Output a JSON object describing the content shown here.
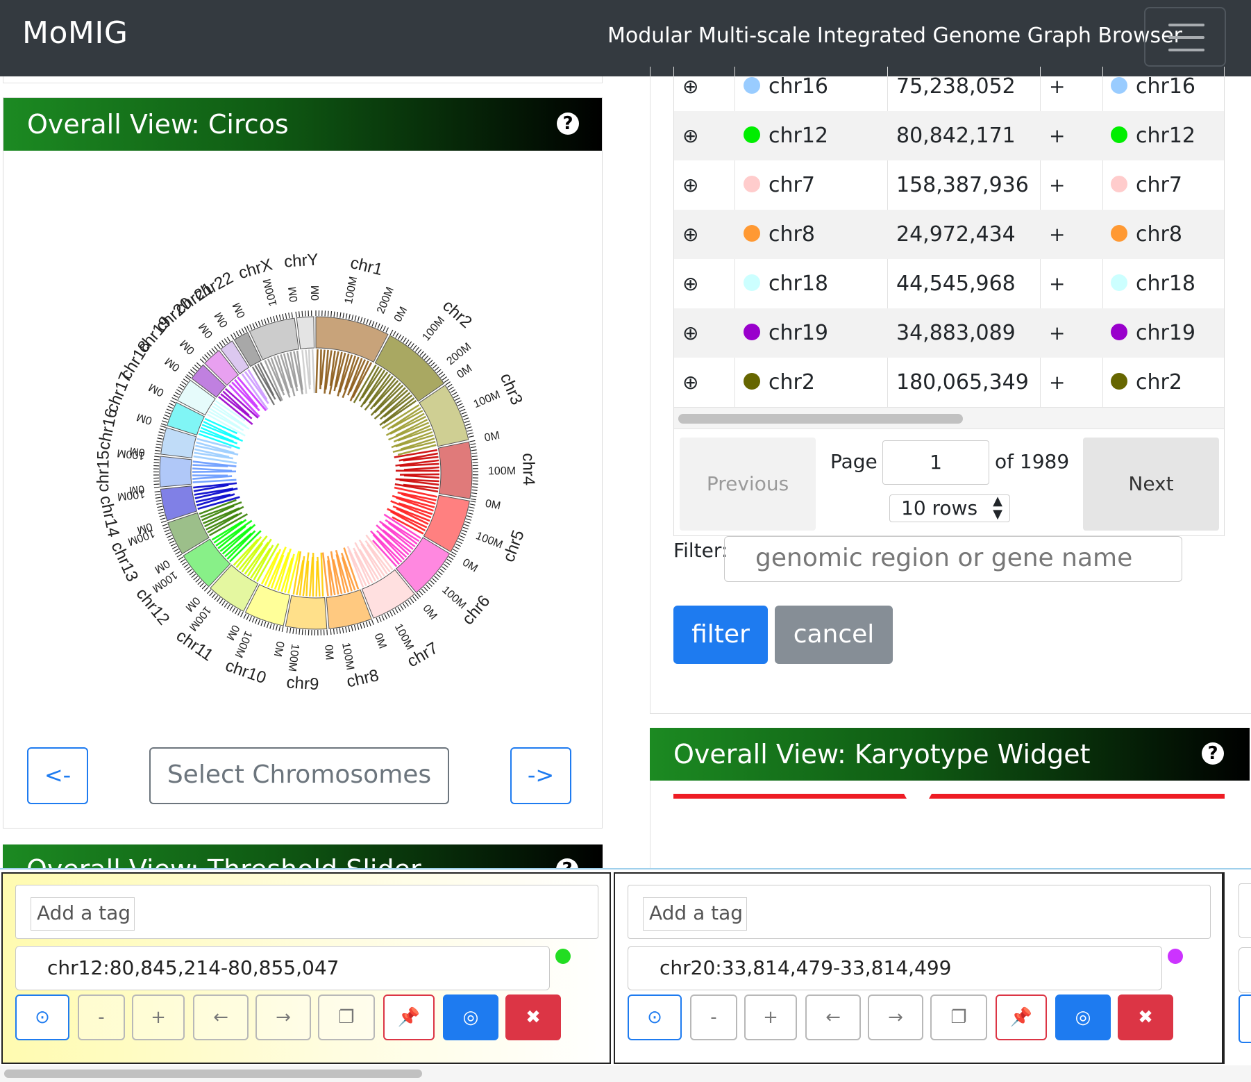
{
  "navbar": {
    "brand": "MoMIG",
    "title": "Modular Multi-scale Integrated Genome Graph Browser"
  },
  "circos_panel": {
    "header": "Overall View: Circos",
    "help": "?",
    "prev_label": "<-",
    "next_label": "->",
    "select_label": "Select Chromosomes",
    "chromosomes": [
      {
        "name": "chr1",
        "color": "#c8a37a",
        "ribbon": "#8b5a16"
      },
      {
        "name": "chr2",
        "color": "#a9a862",
        "ribbon": "#6b6b16"
      },
      {
        "name": "chr3",
        "color": "#cfcf93",
        "ribbon": "#9a9a2c"
      },
      {
        "name": "chr4",
        "color": "#e07a7a",
        "ribbon": "#cc0000"
      },
      {
        "name": "chr5",
        "color": "#ff8080",
        "ribbon": "#ff1a1a"
      },
      {
        "name": "chr6",
        "color": "#ff88e0",
        "ribbon": "#ff33cc"
      },
      {
        "name": "chr7",
        "color": "#ffe0e0",
        "ribbon": "#ffcccc"
      },
      {
        "name": "chr8",
        "color": "#ffc980",
        "ribbon": "#ff9933"
      },
      {
        "name": "chr9",
        "color": "#ffe08a",
        "ribbon": "#ffcc00"
      },
      {
        "name": "chr10",
        "color": "#ffff99",
        "ribbon": "#ffff00"
      },
      {
        "name": "chr11",
        "color": "#e4f7a0",
        "ribbon": "#ccff00"
      },
      {
        "name": "chr12",
        "color": "#88f088",
        "ribbon": "#00ff00"
      },
      {
        "name": "chr13",
        "color": "#9cbf8a",
        "ribbon": "#358000"
      },
      {
        "name": "chr14",
        "color": "#8080e6",
        "ribbon": "#0000cc"
      },
      {
        "name": "chr15",
        "color": "#b0c8f8",
        "ribbon": "#6699ff"
      },
      {
        "name": "chr16",
        "color": "#c0dcf8",
        "ribbon": "#99ccff"
      },
      {
        "name": "chr17",
        "color": "#80f5f5",
        "ribbon": "#00ffff"
      },
      {
        "name": "chr18",
        "color": "#e6fbfb",
        "ribbon": "#ccffff"
      },
      {
        "name": "chr19",
        "color": "#c080e0",
        "ribbon": "#9900cc"
      },
      {
        "name": "chr20",
        "color": "#e8a0f0",
        "ribbon": "#cc33ff"
      },
      {
        "name": "chr21",
        "color": "#dcc8f0",
        "ribbon": "#cc99ff"
      },
      {
        "name": "chr22",
        "color": "#a8a8a8",
        "ribbon": "#666666"
      },
      {
        "name": "chrX",
        "color": "#cccccc",
        "ribbon": "#999999"
      },
      {
        "name": "chrY",
        "color": "#e4e4e4",
        "ribbon": "#cccccc"
      }
    ],
    "tick_labels": [
      "0M",
      "100M",
      "200M"
    ]
  },
  "threshold_panel": {
    "header": "Overall View: Threshold Slider",
    "help": "?"
  },
  "sv_table": {
    "expand_symbol": "⊕",
    "rows": [
      {
        "chr1": "chr16",
        "pos": "75,238,052",
        "strand": "+",
        "chr2": "chr16",
        "color": "#99ccff"
      },
      {
        "chr1": "chr12",
        "pos": "80,842,171",
        "strand": "+",
        "chr2": "chr12",
        "color": "#00ee00"
      },
      {
        "chr1": "chr7",
        "pos": "158,387,936",
        "strand": "+",
        "chr2": "chr7",
        "color": "#ffcccc"
      },
      {
        "chr1": "chr8",
        "pos": "24,972,434",
        "strand": "+",
        "chr2": "chr8",
        "color": "#ff9933"
      },
      {
        "chr1": "chr18",
        "pos": "44,545,968",
        "strand": "+",
        "chr2": "chr18",
        "color": "#ccffff"
      },
      {
        "chr1": "chr19",
        "pos": "34,883,089",
        "strand": "+",
        "chr2": "chr19",
        "color": "#9900cc"
      },
      {
        "chr1": "chr2",
        "pos": "180,065,349",
        "strand": "+",
        "chr2": "chr2",
        "color": "#666600"
      }
    ],
    "pagination": {
      "previous": "Previous",
      "page_label": "Page",
      "page_value": "1",
      "of_label": "of 1989",
      "rows_option": "10 rows",
      "next": "Next"
    },
    "filter": {
      "label": "Filter:",
      "placeholder": "genomic region or gene name",
      "filter_button": "filter",
      "cancel_button": "cancel"
    }
  },
  "karyotype_panel": {
    "header": "Overall View: Karyotype Widget",
    "help": "?"
  },
  "region_cards": [
    {
      "tag_placeholder": "Add a tag",
      "region": "chr12:80,845,214-80,855,047",
      "dot_color": "#22dd22",
      "controls": {
        "focus": "⊙",
        "minus": "-",
        "plus": "+",
        "left": "←",
        "right": "→",
        "copy": "❐",
        "pin": "📌",
        "locate": "◎",
        "close": "✖"
      }
    },
    {
      "tag_placeholder": "Add a tag",
      "region": "chr20:33,814,479-33,814,499",
      "dot_color": "#cc33ff",
      "controls": {
        "focus": "⊙",
        "minus": "-",
        "plus": "+",
        "left": "←",
        "right": "→",
        "copy": "❐",
        "pin": "📌",
        "locate": "◎",
        "close": "✖"
      }
    }
  ],
  "colors": {
    "navbar_bg": "#343a40",
    "primary": "#1e7bf0",
    "secondary": "#868e96",
    "danger": "#dc3545",
    "header_green": "#1c8a22"
  }
}
